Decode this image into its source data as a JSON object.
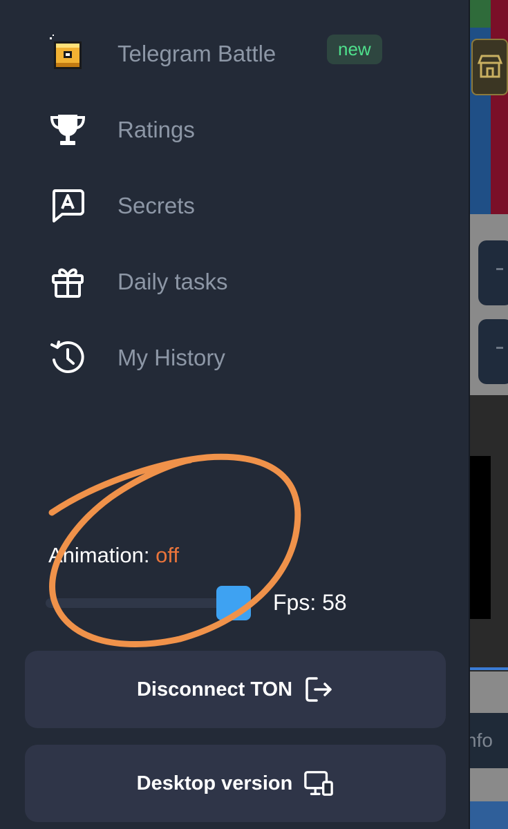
{
  "menu": {
    "items": [
      {
        "label": "Telegram Battle",
        "icon": "pixel-cube-icon",
        "badge": "new"
      },
      {
        "label": "Ratings",
        "icon": "trophy-icon"
      },
      {
        "label": "Secrets",
        "icon": "secret-letter-icon"
      },
      {
        "label": "Daily tasks",
        "icon": "gift-icon"
      },
      {
        "label": "My History",
        "icon": "clock-history-icon"
      }
    ]
  },
  "settings": {
    "animation_label": "Animation:",
    "animation_value": "off",
    "fps_label": "Fps: 58"
  },
  "buttons": {
    "disconnect_label": "Disconnect TON",
    "desktop_label": "Desktop version"
  },
  "background": {
    "info_fragment": "nfo"
  },
  "colors": {
    "drawer_bg": "#232a37",
    "badge_text": "#4fe08c",
    "animation_off": "#e9743b",
    "slider_thumb": "#3ea2f2",
    "annotation": "#f0924a"
  }
}
